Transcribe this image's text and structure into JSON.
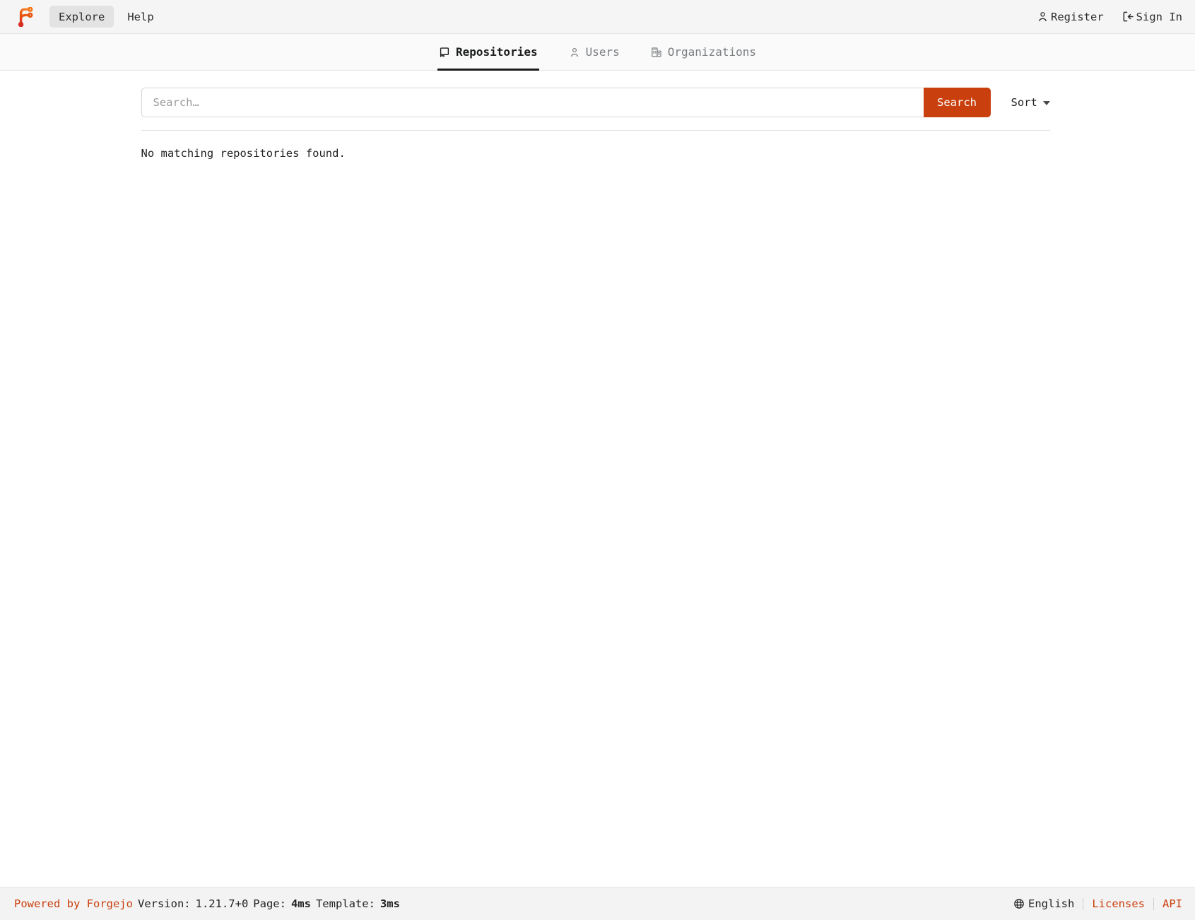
{
  "brand": {
    "logo_icon": "forgejo-logo-icon",
    "logo_colors": [
      "#fb923c",
      "#ea580c",
      "#c9400e",
      "#dc2626"
    ]
  },
  "navbar": {
    "items": [
      {
        "label": "Explore",
        "active": true,
        "name": "nav-item-explore"
      },
      {
        "label": "Help",
        "active": false,
        "name": "nav-item-help"
      }
    ],
    "right": [
      {
        "label": "Register",
        "icon": "person-icon",
        "name": "nav-link-register"
      },
      {
        "label": "Sign In",
        "icon": "sign-in-icon",
        "name": "nav-link-sign-in"
      }
    ]
  },
  "tabs": [
    {
      "label": "Repositories",
      "icon": "repo-icon",
      "active": true
    },
    {
      "label": "Users",
      "icon": "person-icon",
      "active": false
    },
    {
      "label": "Organizations",
      "icon": "organization-icon",
      "active": false
    }
  ],
  "search": {
    "value": "",
    "placeholder": "Search…",
    "button_label": "Search",
    "sort_label": "Sort"
  },
  "results": {
    "empty_message": "No matching repositories found."
  },
  "footer": {
    "powered_by": "Powered by Forgejo",
    "version_label": "Version:",
    "version_value": "1.21.7+0",
    "page_label": "Page:",
    "page_value": "4ms",
    "template_label": "Template:",
    "template_value": "3ms",
    "language": "English",
    "licenses": "Licenses",
    "api": "API"
  },
  "colors": {
    "accent": "#c9400e",
    "navbar_bg": "#f5f5f5",
    "footer_bg": "#f3f3f3",
    "text": "#232323",
    "muted": "#7a7d80"
  }
}
